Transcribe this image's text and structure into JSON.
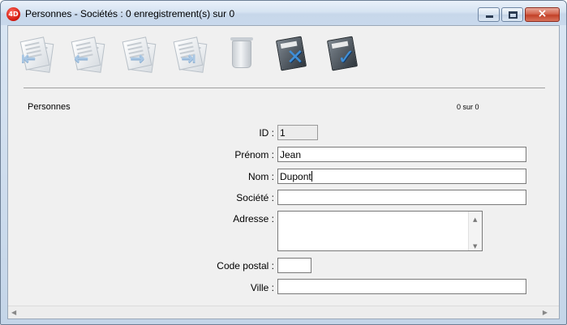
{
  "window": {
    "title": "Personnes - Sociétés : 0 enregistrement(s) sur 0",
    "app_icon_text": "4D"
  },
  "toolbar": {
    "buttons": [
      {
        "name": "first-record",
        "icon": "first-record-icon"
      },
      {
        "name": "previous-record",
        "icon": "previous-record-icon"
      },
      {
        "name": "next-record",
        "icon": "next-record-icon"
      },
      {
        "name": "last-record",
        "icon": "last-record-icon"
      },
      {
        "name": "delete-record",
        "icon": "trash-icon"
      },
      {
        "name": "cancel",
        "icon": "cancel-icon",
        "glyph": "✕"
      },
      {
        "name": "validate",
        "icon": "validate-icon",
        "glyph": "✓"
      }
    ]
  },
  "form": {
    "section_title": "Personnes",
    "record_count": "0 sur 0",
    "fields": {
      "id": {
        "label": "ID :",
        "value": "1"
      },
      "prenom": {
        "label": "Prénom :",
        "value": "Jean"
      },
      "nom": {
        "label": "Nom :",
        "value": "Dupont"
      },
      "societe": {
        "label": "Société :",
        "value": ""
      },
      "adresse": {
        "label": "Adresse :",
        "value": ""
      },
      "code_postal": {
        "label": "Code postal :",
        "value": ""
      },
      "ville": {
        "label": "Ville :",
        "value": ""
      }
    }
  },
  "colors": {
    "window_background": "#f0f0f0",
    "titlebar": "#d6e3f2",
    "close_button": "#c24128"
  }
}
